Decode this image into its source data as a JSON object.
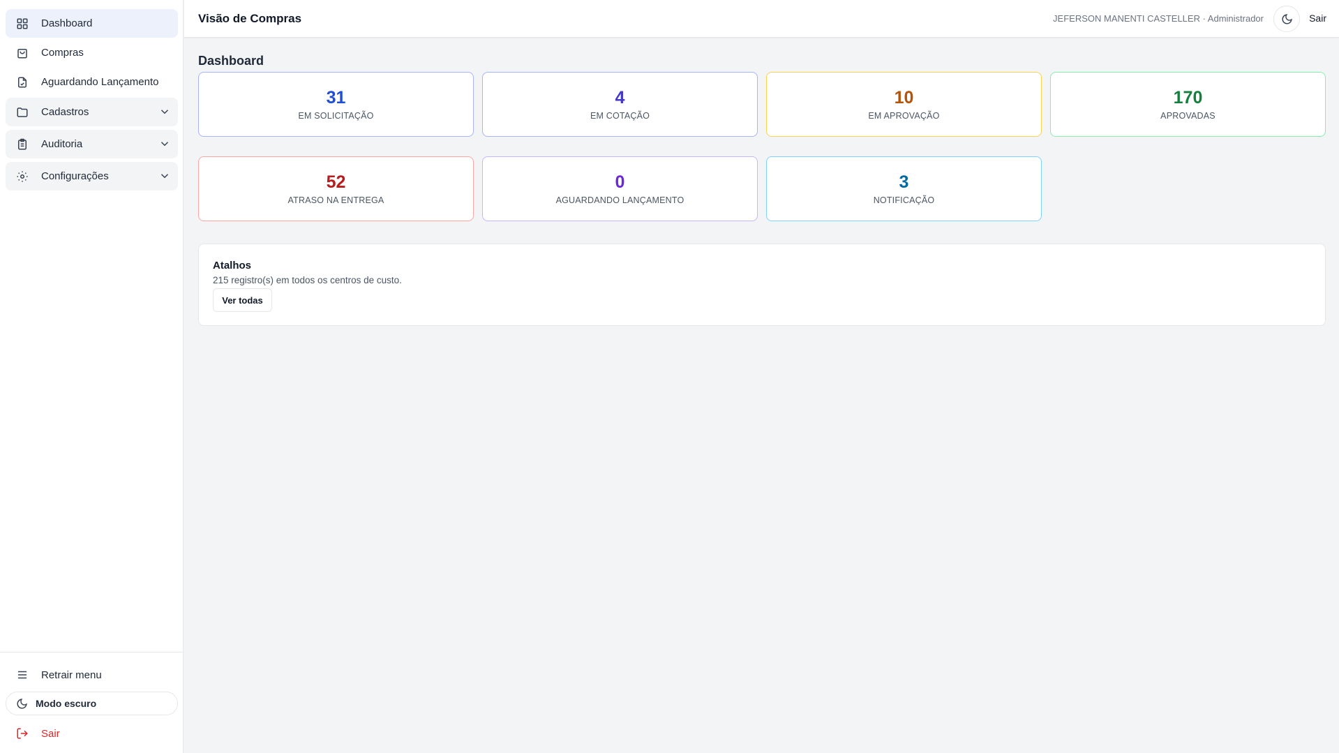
{
  "sidebar": {
    "items": [
      {
        "label": "Dashboard",
        "icon": "grid-icon"
      },
      {
        "label": "Compras",
        "icon": "shopping-bag-icon"
      },
      {
        "label": "Aguardando Lançamento",
        "icon": "file-check-icon"
      },
      {
        "label": "Cadastros",
        "icon": "folder-icon"
      },
      {
        "label": "Auditoria",
        "icon": "clipboard-icon"
      },
      {
        "label": "Configurações",
        "icon": "sun-gear-icon"
      }
    ],
    "footer": {
      "collapse_label": "Retrair menu",
      "dark_mode_label": "Modo escuro",
      "logout_label": "Sair"
    }
  },
  "header": {
    "title": "Visão de Compras",
    "user": "JEFERSON MANENTI CASTELLER · Administrador",
    "logout_label": "Sair"
  },
  "main": {
    "title": "Dashboard",
    "cards": [
      {
        "value": "31",
        "label": "EM SOLICITAÇÃO",
        "color": "#1d4ed8",
        "border": "#a5b4fc"
      },
      {
        "value": "4",
        "label": "EM COTAÇÃO",
        "color": "#4338ca",
        "border": "#a5b4fc"
      },
      {
        "value": "10",
        "label": "EM APROVAÇÃO",
        "color": "#b45309",
        "border": "#fcd34d"
      },
      {
        "value": "170",
        "label": "APROVADAS",
        "color": "#15803d",
        "border": "#86efac"
      },
      {
        "value": "52",
        "label": "ATRASO NA ENTREGA",
        "color": "#b91c1c",
        "border": "#fca5a5"
      },
      {
        "value": "0",
        "label": "AGUARDANDO LANÇAMENTO",
        "color": "#6d28d9",
        "border": "#c4b5fd"
      },
      {
        "value": "3",
        "label": "NOTIFICAÇÃO",
        "color": "#0369a1",
        "border": "#7dd3fc"
      }
    ],
    "shortcuts": {
      "title": "Atalhos",
      "subtitle": "215 registro(s) em todos os centros de custo.",
      "button_label": "Ver todas"
    }
  }
}
